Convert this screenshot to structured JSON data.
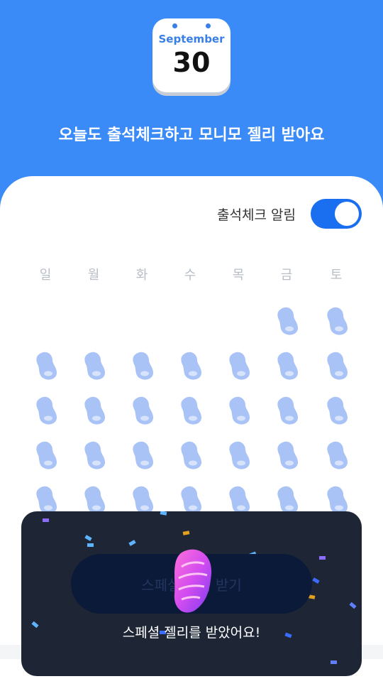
{
  "calendar_icon": {
    "month": "September",
    "day": "30"
  },
  "headline": "오늘도 출석체크하고 모니모 젤리 받아요",
  "alarm": {
    "label": "출석체크 알림",
    "enabled": true
  },
  "weekdays": [
    "일",
    "월",
    "화",
    "수",
    "목",
    "금",
    "토"
  ],
  "attendance_grid": [
    [
      false,
      false,
      false,
      false,
      false,
      true,
      true
    ],
    [
      true,
      true,
      true,
      true,
      true,
      true,
      true
    ],
    [
      true,
      true,
      true,
      true,
      true,
      true,
      true
    ],
    [
      true,
      true,
      true,
      true,
      true,
      true,
      true
    ],
    [
      true,
      true,
      true,
      true,
      true,
      true,
      true
    ]
  ],
  "special_button": {
    "label": "스페셜 젤리 받기"
  },
  "toast": {
    "message": "스페셜 젤리를 받았어요!"
  },
  "colors": {
    "header_bg": "#3a8bf8",
    "toggle_on": "#1a6ef0",
    "jelly": "#a9c3f7",
    "overlay_bg": "#1e2636"
  }
}
